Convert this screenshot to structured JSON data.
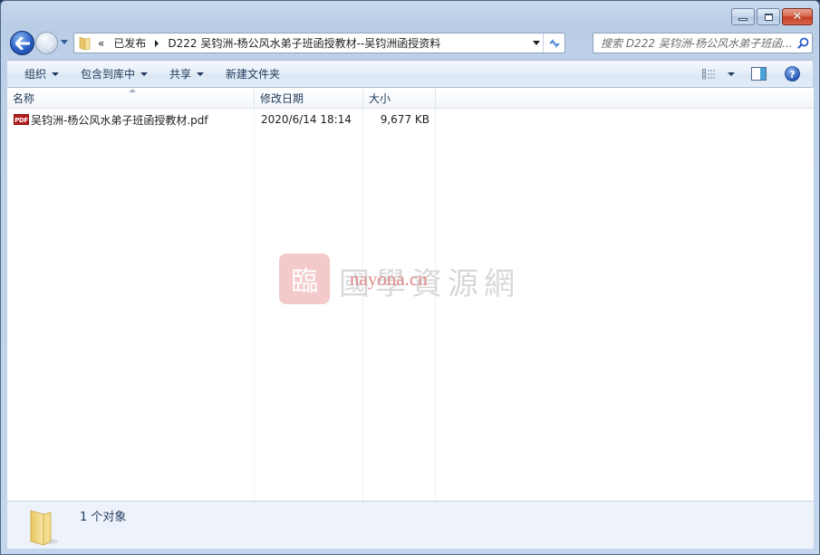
{
  "window": {
    "caption_buttons": {
      "minimize": "minimize",
      "maximize": "maximize",
      "close": "✕"
    }
  },
  "navigation": {
    "address": {
      "overflow_glyph": "«",
      "breadcrumbs": [
        {
          "label": "已发布"
        },
        {
          "label": "D222 吴钧洲-杨公风水弟子班函授教材--吴钧洲函授资料"
        }
      ]
    },
    "refresh_glyph": "↻",
    "search": {
      "placeholder": "搜索 D222 吴钧洲-杨公风水弟子班函..."
    }
  },
  "command_bar": {
    "items": [
      {
        "label": "组织",
        "has_dropdown": true
      },
      {
        "label": "包含到库中",
        "has_dropdown": true
      },
      {
        "label": "共享",
        "has_dropdown": true
      },
      {
        "label": "新建文件夹",
        "has_dropdown": false
      }
    ]
  },
  "file_list": {
    "columns": [
      {
        "label": "名称",
        "sorted": "ascending"
      },
      {
        "label": "修改日期"
      },
      {
        "label": "大小"
      }
    ],
    "rows": [
      {
        "icon": "pdf-icon",
        "icon_label": "PDF",
        "name": "吴钧洲-杨公风水弟子班函授教材.pdf",
        "modified": "2020/6/14 18:14",
        "size": "9,677 KB"
      }
    ]
  },
  "watermark": {
    "seal_glyph": "臨",
    "chars": "國學資源網",
    "url": "nayona.cn"
  },
  "details_pane": {
    "summary": "1 个对象"
  },
  "colors": {
    "accent": "#2a5fc4",
    "close_button": "#c33b21",
    "pdf_icon": "#b41d1d"
  }
}
